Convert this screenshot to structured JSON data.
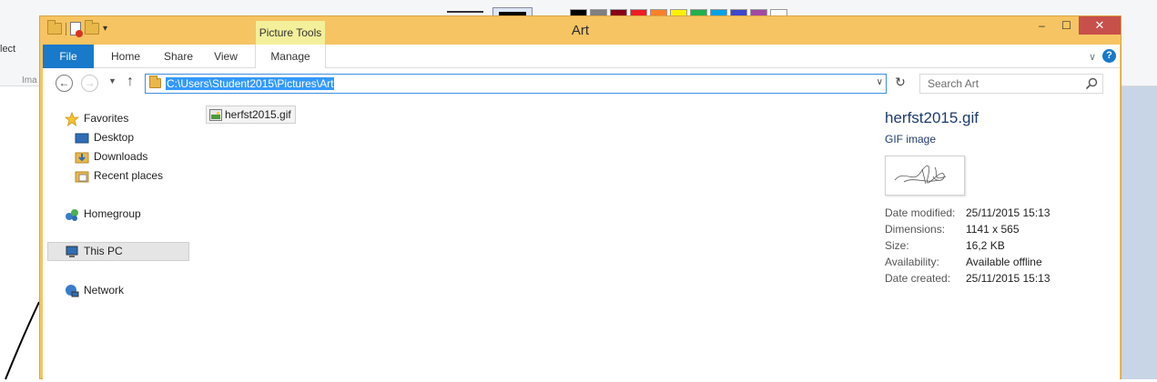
{
  "background_app": {
    "select_label": "lect",
    "image_group_label": "Ima",
    "palette_colors": [
      "#000000",
      "#7f7f7f",
      "#880015",
      "#ed1c24",
      "#ff7f27",
      "#fff200",
      "#22b14c",
      "#00a2e8",
      "#3f48cc",
      "#a349a4",
      "#ffffff"
    ]
  },
  "window": {
    "title": "Art",
    "context_tab_group": "Picture Tools",
    "controls": {
      "minimize": "‒",
      "maximize": "☐",
      "close": "✕"
    }
  },
  "ribbon": {
    "tabs": [
      {
        "label": "File"
      },
      {
        "label": "Home"
      },
      {
        "label": "Share"
      },
      {
        "label": "View"
      },
      {
        "label": "Manage"
      }
    ],
    "help": "?"
  },
  "address_bar": {
    "path": "C:\\Users\\Student2015\\Pictures\\Art",
    "search_placeholder": "Search Art"
  },
  "nav_pane": {
    "favorites": "Favorites",
    "desktop": "Desktop",
    "downloads": "Downloads",
    "recent_places": "Recent places",
    "homegroup": "Homegroup",
    "this_pc": "This PC",
    "network": "Network"
  },
  "files": [
    {
      "name": "herfst2015.gif"
    }
  ],
  "details": {
    "name": "herfst2015.gif",
    "type": "GIF image",
    "properties": [
      {
        "label": "Date modified:",
        "value": "25/11/2015 15:13"
      },
      {
        "label": "Dimensions:",
        "value": "1141 x 565"
      },
      {
        "label": "Size:",
        "value": "16,2 KB"
      },
      {
        "label": "Availability:",
        "value": "Available offline"
      },
      {
        "label": "Date created:",
        "value": "25/11/2015 15:13"
      }
    ]
  },
  "colors": {
    "title_bar": "#f6c462",
    "file_tab": "#1979ca",
    "picture_tools": "#f3ef9a",
    "close_button": "#c7504b",
    "selection": "#3399ff"
  }
}
